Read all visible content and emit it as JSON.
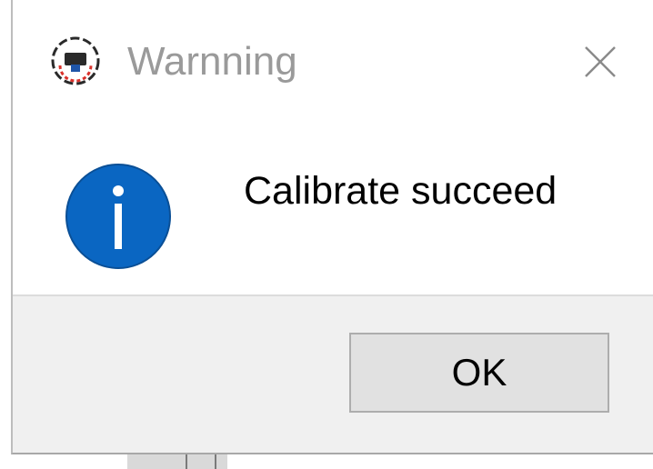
{
  "window": {
    "title": "Warnning",
    "app_icon": "camera-app-icon",
    "close_icon": "close-icon"
  },
  "message": {
    "icon": "info-icon",
    "text": "Calibrate succeed"
  },
  "buttons": {
    "ok_label": "OK"
  },
  "colors": {
    "info_blue": "#0a66c2",
    "title_gray": "#9a9a9a",
    "footer_bg": "#f0f0f0",
    "button_bg": "#e1e1e1"
  }
}
